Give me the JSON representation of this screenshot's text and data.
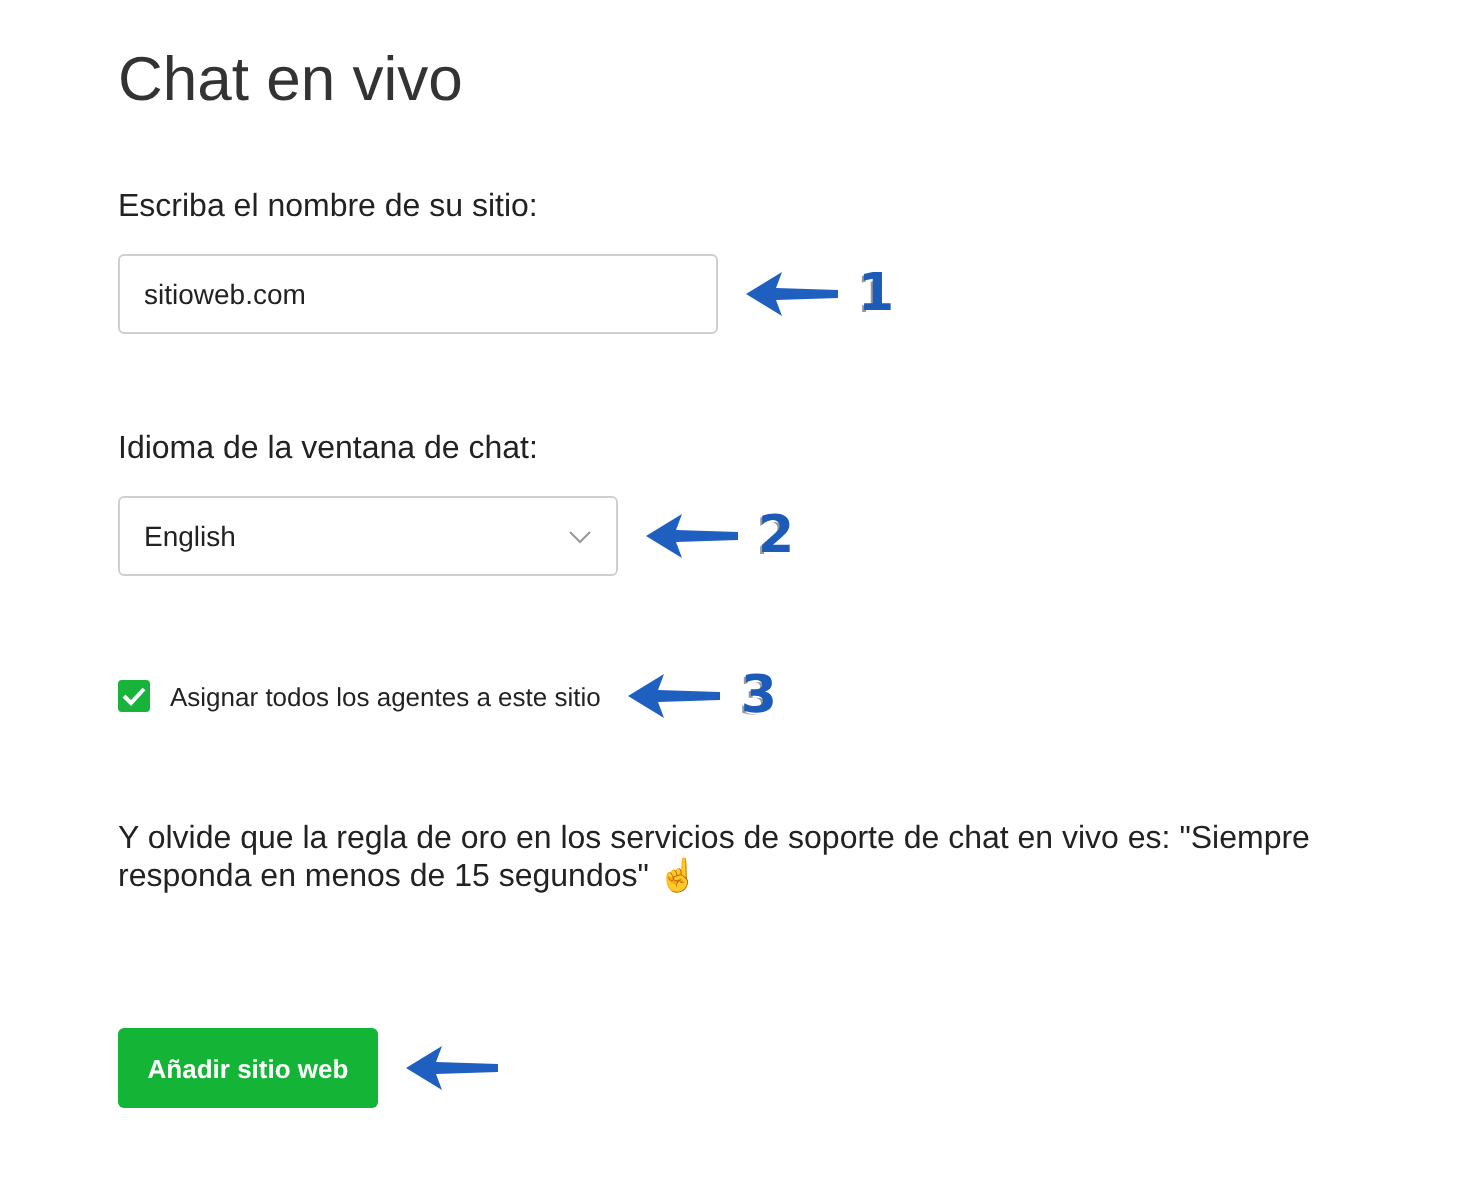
{
  "title": "Chat en vivo",
  "site_field": {
    "label": "Escriba el nombre de su sitio:",
    "value": "sitioweb.com",
    "annotation": "1"
  },
  "language_select": {
    "label": "Idioma de la ventana de chat:",
    "value": "English",
    "annotation": "2"
  },
  "assign_checkbox": {
    "label": "Asignar todos los agentes a este sitio",
    "checked": true,
    "annotation": "3"
  },
  "note": "Y olvide que la regla de oro en los servicios de soporte de chat en vivo es: \"Siempre responda en menos de 15 segundos\" ☝",
  "add_button": {
    "label": "Añadir sitio web"
  }
}
